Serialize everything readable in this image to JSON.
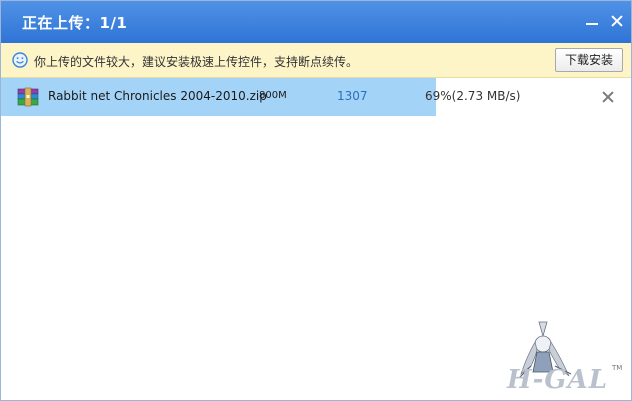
{
  "titlebar": {
    "title": "正在上传：1/1",
    "minimize_icon": "minimize-icon",
    "close_icon": "close-icon"
  },
  "notice": {
    "icon": "smile-icon",
    "text": "你上传的文件较大，建议安装极速上传控件，支持断点续传。",
    "button_label": "下载安装"
  },
  "upload": {
    "file_icon": "winrar-archive-icon",
    "file_name": "Rabbit net Chronicles 2004-2010.zip",
    "size": "800M",
    "count": "1307",
    "status": "69%(2.73 MB/s)",
    "progress_fraction": 0.69,
    "progress_color": "#a4d3f8"
  },
  "watermark": {
    "text": "H-GAL",
    "tm": "TM"
  },
  "colors": {
    "titlebar": "#3a7fdc",
    "notice_bg": "#fdf4c8",
    "accent_text": "#2a6fc0"
  }
}
